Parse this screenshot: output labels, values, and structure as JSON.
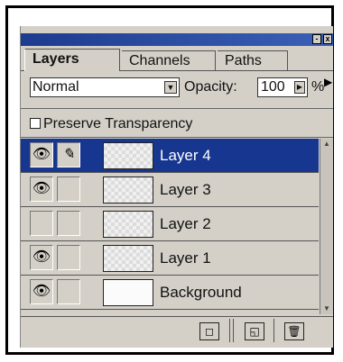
{
  "titlebar": {
    "minimize_label": "-",
    "close_label": "x"
  },
  "tabs": [
    {
      "label": "Layers",
      "active": true
    },
    {
      "label": "Channels",
      "active": false
    },
    {
      "label": "Paths",
      "active": false
    }
  ],
  "tab_scroll": "▶",
  "blend_mode": {
    "value": "Normal",
    "dropdown_glyph": "▼"
  },
  "opacity": {
    "label": "Opacity:",
    "value": "100",
    "arrow": "▶",
    "unit": "%"
  },
  "preserve_transparency": {
    "label": "Preserve Transparency",
    "checked": false
  },
  "layers": [
    {
      "name": "Layer 4",
      "visible": true,
      "brush": true,
      "selected": true,
      "transparent_thumb": true
    },
    {
      "name": "Layer 3",
      "visible": true,
      "brush": false,
      "selected": false,
      "transparent_thumb": true
    },
    {
      "name": "Layer 2",
      "visible": false,
      "brush": false,
      "selected": false,
      "transparent_thumb": true
    },
    {
      "name": "Layer 1",
      "visible": true,
      "brush": false,
      "selected": false,
      "transparent_thumb": true
    },
    {
      "name": "Background",
      "visible": true,
      "brush": false,
      "selected": false,
      "transparent_thumb": false
    }
  ],
  "icons": {
    "eye": "👁",
    "brush": "✎",
    "mask": "◻",
    "new_layer": "◱",
    "trash": "🗑"
  },
  "colors": {
    "selection": "#16368f",
    "titlebar": "#1d3b8f",
    "panel": "#d4d0c8"
  }
}
